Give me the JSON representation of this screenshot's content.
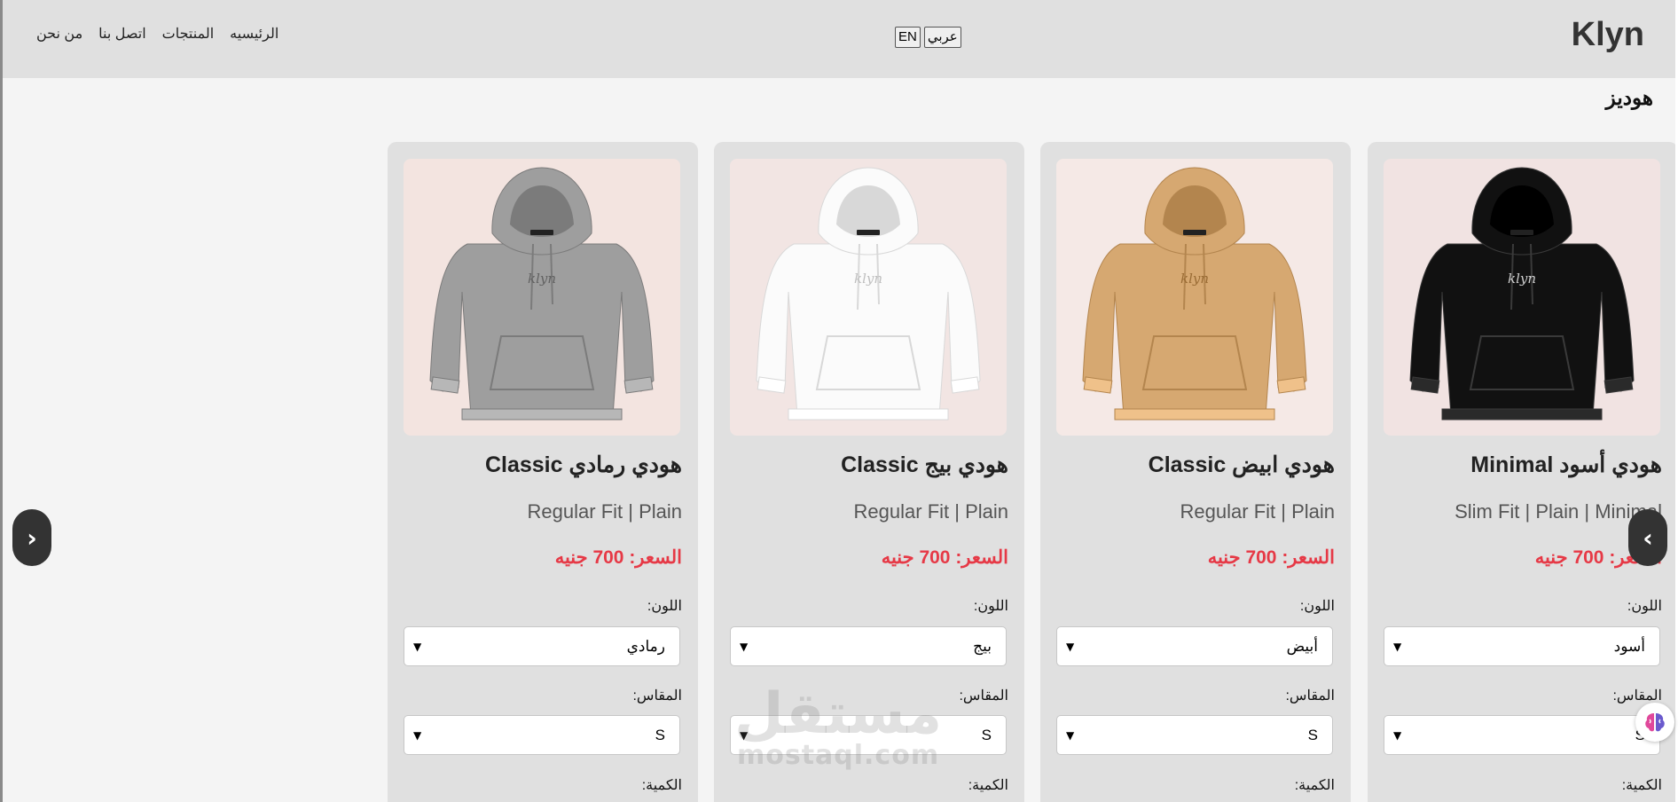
{
  "header": {
    "logo": "Klyn",
    "lang_en": "EN",
    "lang_ar": "عربي",
    "nav": [
      "الرئيسيه",
      "المنتجات",
      "اتصل بنا",
      "من نحن"
    ]
  },
  "section_title": "هوديز",
  "labels": {
    "color": "اللون:",
    "size": "المقاس:",
    "qty": "الكمية:"
  },
  "products": [
    {
      "title": "هودي أسود Minimal",
      "fit": "Slim Fit | Plain | Minimal",
      "price": "السعر: 700 جنيه",
      "color": "أسود",
      "size": "S",
      "hoodie_color": "#111111",
      "bg_color": "#f1e3e2"
    },
    {
      "title": "هودي ابيض Classic",
      "fit": "Regular Fit | Plain",
      "price": "السعر: 700 جنيه",
      "color": "أبيض",
      "size": "S",
      "hoodie_color": "#d6a871",
      "bg_color": "#f5e9e6"
    },
    {
      "title": "هودي بيج Classic",
      "fit": "Regular Fit | Plain",
      "price": "السعر: 700 جنيه",
      "color": "بيج",
      "size": "S",
      "hoodie_color": "#fbfbfb",
      "bg_color": "#f2e5e3"
    },
    {
      "title": "هودي رمادي Classic",
      "fit": "Regular Fit | Plain",
      "price": "السعر: 700 جنيه",
      "color": "رمادي",
      "size": "S",
      "hoodie_color": "#9e9e9e",
      "bg_color": "#f3e4e0"
    }
  ],
  "hoodie_brand": "klyn",
  "arrows": {
    "prev": "‹",
    "next": "›"
  },
  "watermark": {
    "line1": "مستقل",
    "line2": "mostaql.com"
  },
  "accent_color": "#e63946"
}
